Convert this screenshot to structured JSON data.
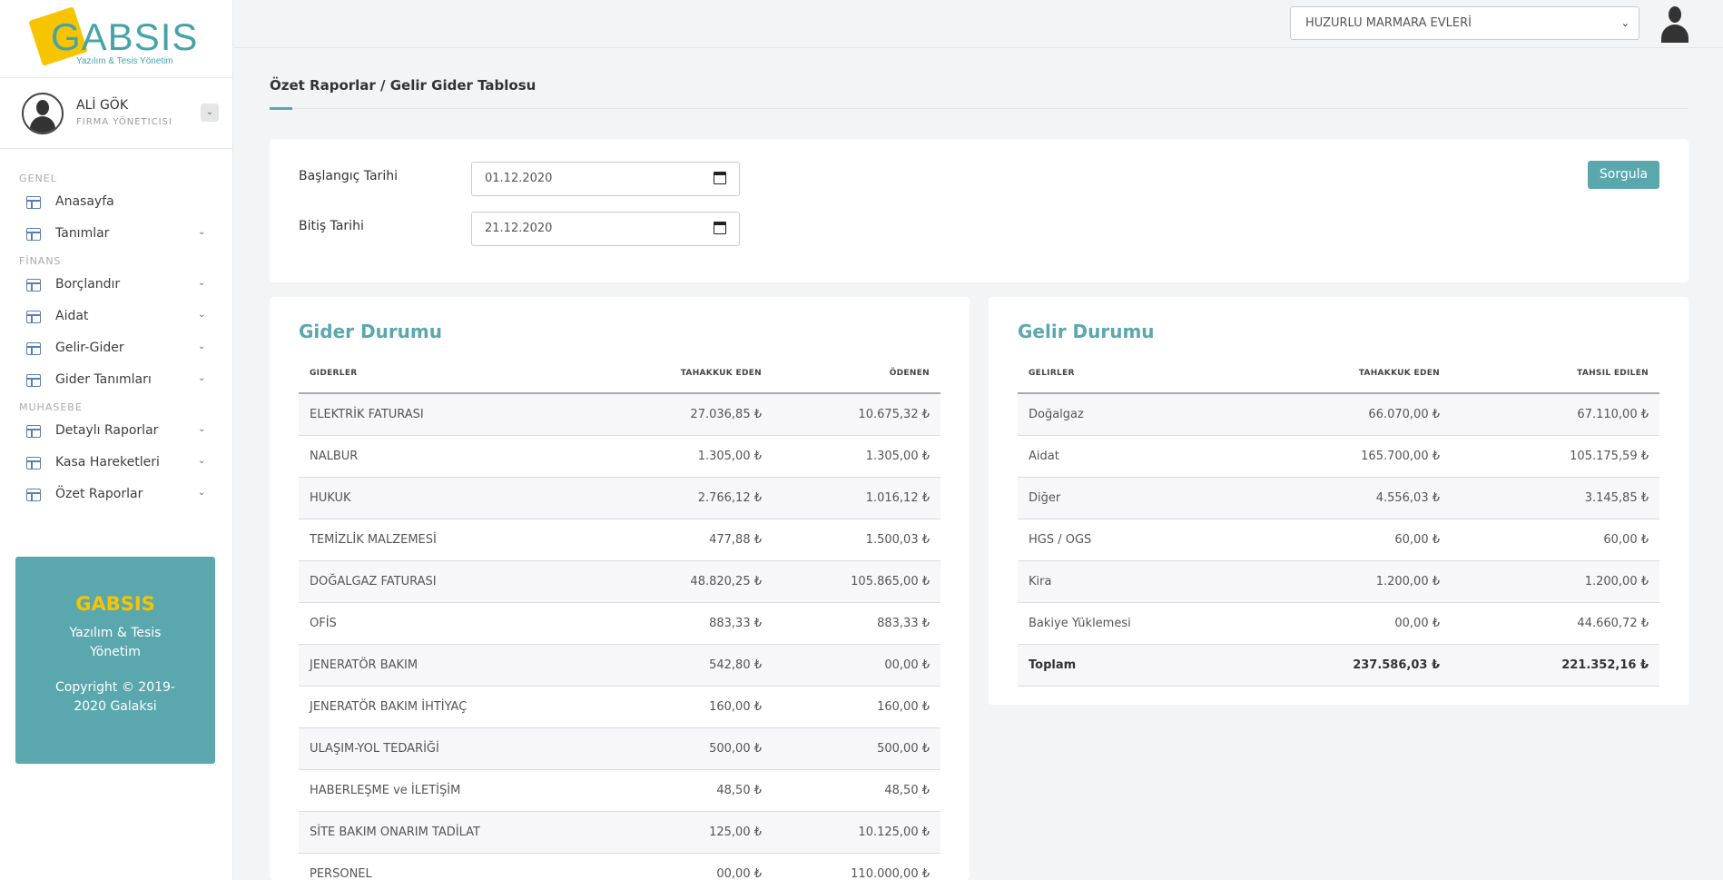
{
  "brand": {
    "logo_text": "GABSIS",
    "logo_sub": "Yazılım & Tesis Yönetim"
  },
  "user": {
    "name": "ALİ GÖK",
    "role": "FIRMA YÖNETICISI"
  },
  "nav": {
    "section_general": "GENEL",
    "section_finance": "FİNANS",
    "section_accounting": "MUHASEBE",
    "items": [
      {
        "label": "Anasayfa"
      },
      {
        "label": "Tanımlar"
      },
      {
        "label": "Borçlandır"
      },
      {
        "label": "Aidat"
      },
      {
        "label": "Gelir-Gider"
      },
      {
        "label": "Gider Tanımları"
      },
      {
        "label": "Detaylı Raporlar"
      },
      {
        "label": "Kasa Hareketleri"
      },
      {
        "label": "Özet Raporlar"
      }
    ]
  },
  "promo": {
    "title": "GABSIS",
    "subtitle": "Yazılım & Tesis Yönetim",
    "copyright": "Copyright © 2019-2020 Galaksi"
  },
  "topbar": {
    "site_selected": "HUZURLU MARMARA EVLERİ"
  },
  "breadcrumb": "Özet Raporlar / Gelir Gider Tablosu",
  "filter": {
    "start_label": "Başlangıç Tarihi",
    "start_value": "01.12.2020",
    "end_label": "Bitiş Tarihi",
    "end_value": "21.12.2020",
    "query_button": "Sorgula"
  },
  "expenses": {
    "title": "Gider Durumu",
    "headers": [
      "GIDERLER",
      "TAHAKKUK EDEN",
      "ÖDENEN"
    ],
    "rows": [
      [
        "ELEKTRİK FATURASI",
        "27.036,85 ₺",
        "10.675,32 ₺"
      ],
      [
        "NALBUR",
        "1.305,00 ₺",
        "1.305,00 ₺"
      ],
      [
        "HUKUK",
        "2.766,12 ₺",
        "1.016,12 ₺"
      ],
      [
        "TEMİZLİK MALZEMESİ",
        "477,88 ₺",
        "1.500,03 ₺"
      ],
      [
        "DOĞALGAZ FATURASI",
        "48.820,25 ₺",
        "105.865,00 ₺"
      ],
      [
        "OFİS",
        "883,33 ₺",
        "883,33 ₺"
      ],
      [
        "JENERATÖR BAKIM",
        "542,80 ₺",
        "00,00 ₺"
      ],
      [
        "JENERATÖR BAKIM İHTİYAÇ",
        "160,00 ₺",
        "160,00 ₺"
      ],
      [
        "ULAŞIM-YOL TEDARİĞİ",
        "500,00 ₺",
        "500,00 ₺"
      ],
      [
        "HABERLEŞME ve İLETİŞİM",
        "48,50 ₺",
        "48,50 ₺"
      ],
      [
        "SİTE BAKIM ONARIM TADİLAT",
        "125,00 ₺",
        "10.125,00 ₺"
      ],
      [
        "PERSONEL",
        "00,00 ₺",
        "110.000,00 ₺"
      ]
    ]
  },
  "income": {
    "title": "Gelir Durumu",
    "headers": [
      "GELIRLER",
      "TAHAKKUK EDEN",
      "TAHSIL EDILEN"
    ],
    "rows": [
      [
        "Doğalgaz",
        "66.070,00 ₺",
        "67.110,00 ₺"
      ],
      [
        "Aidat",
        "165.700,00 ₺",
        "105.175,59 ₺"
      ],
      [
        "Diğer",
        "4.556,03 ₺",
        "3.145,85 ₺"
      ],
      [
        "HGS / OGS",
        "60,00 ₺",
        "60,00 ₺"
      ],
      [
        "Kira",
        "1.200,00 ₺",
        "1.200,00 ₺"
      ],
      [
        "Bakiye Yüklemesi",
        "00,00 ₺",
        "44.660,72 ₺"
      ]
    ],
    "total": [
      "Toplam",
      "237.586,03 ₺",
      "221.352,16 ₺"
    ]
  }
}
